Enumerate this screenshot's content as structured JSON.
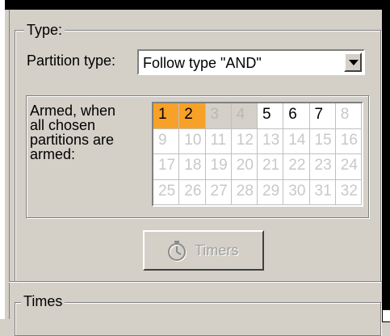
{
  "type_group": {
    "legend": "Type:",
    "partition_type_label": "Partition type:",
    "partition_type_value": "Follow type \"AND\""
  },
  "armed": {
    "label_lines": [
      "Armed, when",
      "all chosen",
      "partitions are",
      "armed:"
    ],
    "cells": [
      {
        "n": "1",
        "state": "selected"
      },
      {
        "n": "2",
        "state": "selected"
      },
      {
        "n": "3",
        "state": "disabled-selected"
      },
      {
        "n": "4",
        "state": "disabled-selected"
      },
      {
        "n": "5",
        "state": "active"
      },
      {
        "n": "6",
        "state": "active"
      },
      {
        "n": "7",
        "state": "active"
      },
      {
        "n": "8",
        "state": "disabled"
      },
      {
        "n": "9",
        "state": "disabled"
      },
      {
        "n": "10",
        "state": "disabled"
      },
      {
        "n": "11",
        "state": "disabled"
      },
      {
        "n": "12",
        "state": "disabled"
      },
      {
        "n": "13",
        "state": "disabled"
      },
      {
        "n": "14",
        "state": "disabled"
      },
      {
        "n": "15",
        "state": "disabled"
      },
      {
        "n": "16",
        "state": "disabled"
      },
      {
        "n": "17",
        "state": "disabled"
      },
      {
        "n": "18",
        "state": "disabled"
      },
      {
        "n": "19",
        "state": "disabled"
      },
      {
        "n": "20",
        "state": "disabled"
      },
      {
        "n": "21",
        "state": "disabled"
      },
      {
        "n": "22",
        "state": "disabled"
      },
      {
        "n": "23",
        "state": "disabled"
      },
      {
        "n": "24",
        "state": "disabled"
      },
      {
        "n": "25",
        "state": "disabled"
      },
      {
        "n": "26",
        "state": "disabled"
      },
      {
        "n": "27",
        "state": "disabled"
      },
      {
        "n": "28",
        "state": "disabled"
      },
      {
        "n": "29",
        "state": "disabled"
      },
      {
        "n": "30",
        "state": "disabled"
      },
      {
        "n": "31",
        "state": "disabled"
      },
      {
        "n": "32",
        "state": "disabled"
      }
    ],
    "selected_color": "#f7a128"
  },
  "timers_button": {
    "label": "Timers",
    "icon": "stopwatch-icon",
    "enabled": false
  },
  "times_group": {
    "legend": "Times"
  }
}
